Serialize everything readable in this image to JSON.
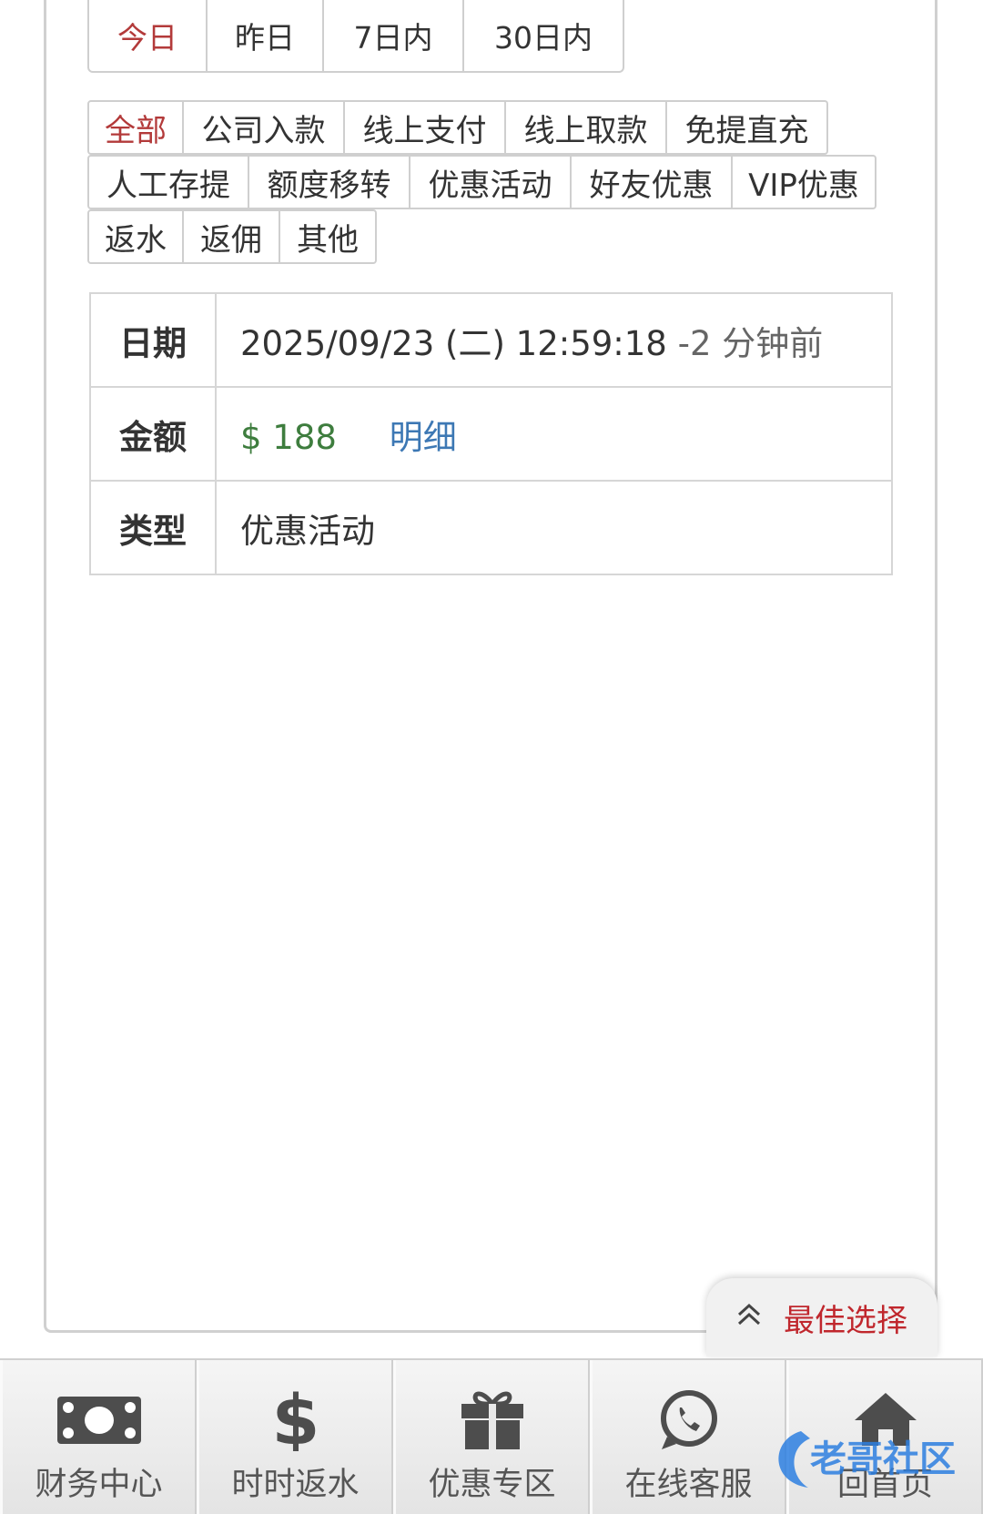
{
  "date_filter": {
    "tabs": [
      "今日",
      "昨日",
      "7日内",
      "30日内"
    ],
    "active": "今日"
  },
  "type_filter": {
    "rows": [
      [
        "全部",
        "公司入款",
        "线上支付",
        "线上取款",
        "免提直充"
      ],
      [
        "人工存提",
        "额度移转",
        "优惠活动",
        "好友优惠",
        "VIP优惠"
      ],
      [
        "返水",
        "返佣",
        "其他"
      ]
    ],
    "active": "全部"
  },
  "record": {
    "date_label": "日期",
    "date_value": "2025/09/23 (二) 12:59:18",
    "date_ago": "-2 分钟前",
    "amount_label": "金额",
    "amount_value": "$ 188",
    "detail_link": "明细",
    "type_label": "类型",
    "type_value": "优惠活动"
  },
  "float_button": {
    "label": "最佳选择",
    "icon": "double-chevron-up-icon"
  },
  "bottom_nav": [
    {
      "label": "财务中心",
      "icon": "cash-icon"
    },
    {
      "label": "时时返水",
      "icon": "dollar-icon"
    },
    {
      "label": "优惠专区",
      "icon": "gift-icon"
    },
    {
      "label": "在线客服",
      "icon": "whatsapp-icon"
    },
    {
      "label": "回首页",
      "icon": "home-icon"
    }
  ],
  "watermark": "老哥社区",
  "colors": {
    "active": "#b33a3a",
    "amount": "#3e7d3e",
    "link": "#3d78b4",
    "float": "#c0272d"
  }
}
